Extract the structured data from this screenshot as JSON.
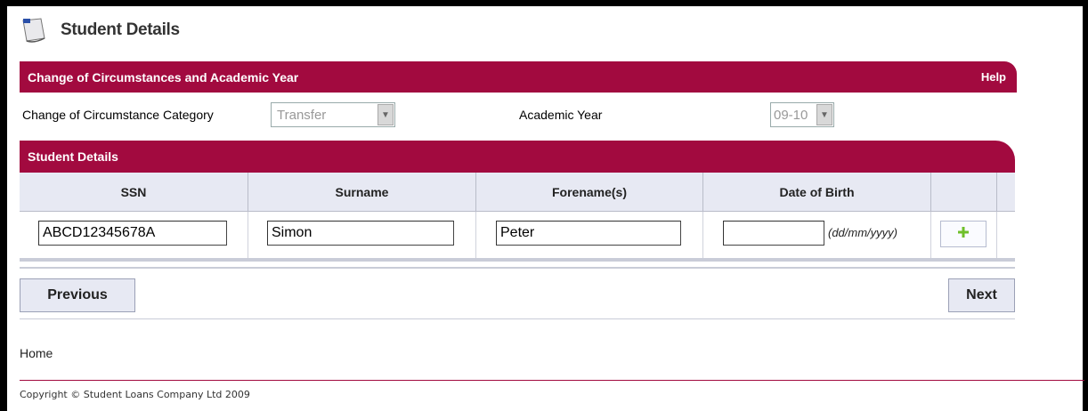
{
  "page": {
    "title": "Student Details"
  },
  "section1": {
    "title": "Change of Circumstances and Academic Year",
    "help_label": "Help",
    "category_label": "Change of Circumstance Category",
    "category_value": "Transfer",
    "year_label": "Academic Year",
    "year_value": "09-10"
  },
  "section2": {
    "title": "Student Details",
    "columns": [
      "SSN",
      "Surname",
      "Forename(s)",
      "Date of Birth"
    ],
    "row": {
      "ssn": "ABCD12345678A",
      "surname": "Simon",
      "forename": "Peter",
      "dob": "",
      "dob_hint": "(dd/mm/yyyy)"
    }
  },
  "nav": {
    "previous_label": "Previous",
    "next_label": "Next"
  },
  "footer": {
    "home_label": "Home",
    "copyright": "Copyright © Student Loans Company Ltd 2009"
  },
  "colors": {
    "brand": "#a20a3f",
    "header_bg": "#e7e9f3",
    "add_icon": "#6fbf2a"
  },
  "icons": {
    "page_icon": "document-icon",
    "add_icon": "plus-icon",
    "dropdown_icon": "chevron-down-icon"
  }
}
